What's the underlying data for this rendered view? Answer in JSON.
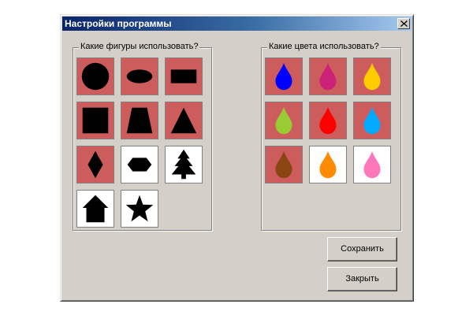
{
  "window": {
    "title": "Настройки программы",
    "close_label": "×"
  },
  "shapes_group": {
    "label": "Какие фигуры использовать?",
    "items": [
      {
        "icon": "circle-icon",
        "selected": true
      },
      {
        "icon": "ellipse-icon",
        "selected": true
      },
      {
        "icon": "rectangle-icon",
        "selected": true
      },
      {
        "icon": "square-icon",
        "selected": true
      },
      {
        "icon": "trapezoid-icon",
        "selected": true
      },
      {
        "icon": "triangle-icon",
        "selected": true
      },
      {
        "icon": "diamond-icon",
        "selected": true
      },
      {
        "icon": "hexagon-icon",
        "selected": false
      },
      {
        "icon": "fir-tree-icon",
        "selected": false
      },
      {
        "icon": "house-icon",
        "selected": false
      },
      {
        "icon": "star-icon",
        "selected": false
      }
    ]
  },
  "colors_group": {
    "label": "Какие цвета использовать?",
    "items": [
      {
        "icon": "drop-icon",
        "color": "#0000ff",
        "selected": true
      },
      {
        "icon": "drop-icon",
        "color": "#cc2277",
        "selected": true
      },
      {
        "icon": "drop-icon",
        "color": "#ffcc00",
        "selected": true
      },
      {
        "icon": "drop-icon",
        "color": "#99cc33",
        "selected": true
      },
      {
        "icon": "drop-icon",
        "color": "#ff0000",
        "selected": true
      },
      {
        "icon": "drop-icon",
        "color": "#00aaff",
        "selected": true
      },
      {
        "icon": "drop-icon",
        "color": "#8b4513",
        "selected": true
      },
      {
        "icon": "drop-icon",
        "color": "#ff8c00",
        "selected": false
      },
      {
        "icon": "drop-icon",
        "color": "#ff77bb",
        "selected": false
      }
    ]
  },
  "buttons": {
    "save_label": "Сохранить",
    "close_label": "Закрыть"
  },
  "colors": {
    "selected_tile": "#cd5c5c",
    "unselected_tile": "#ffffff",
    "shape_fill": "#000000"
  }
}
